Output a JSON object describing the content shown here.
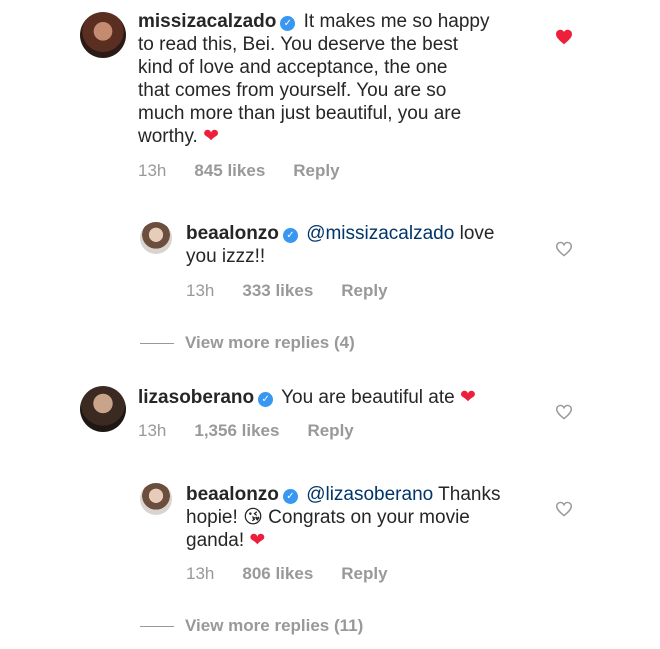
{
  "comments": [
    {
      "username": "missizacalzado",
      "text_lines": [
        "It makes me so happy",
        "to read this, Bei. You deserve the best",
        "kind of love and acceptance, the one",
        "that comes from yourself. You are so",
        "much more than just beautiful, you are",
        "worthy."
      ],
      "emoji_end": "❤",
      "time": "13h",
      "likes": "845 likes",
      "reply_label": "Reply",
      "liked": true
    },
    {
      "username": "beaalonzo",
      "mention": "@missizacalzado",
      "text_after_mention": "love",
      "text_line2": "you izzz!!",
      "time": "13h",
      "likes": "333 likes",
      "reply_label": "Reply",
      "liked": false
    },
    {
      "username": "lizasoberano",
      "text": "You are beautiful ate",
      "emoji_end": "❤",
      "time": "13h",
      "likes": "1,356 likes",
      "reply_label": "Reply",
      "liked": false
    },
    {
      "username": "beaalonzo",
      "mention": "@lizasoberano",
      "text_after_mention": "Thanks",
      "line2_pre": "hopie!",
      "kiss_emoji": "😘",
      "line2_post": "Congrats on your movie",
      "line3": "ganda!",
      "emoji_end": "❤",
      "time": "13h",
      "likes": "806 likes",
      "reply_label": "Reply",
      "liked": false
    }
  ],
  "view_more_1": "View more replies (4)",
  "view_more_2": "View more replies (11)",
  "verified_glyph": "✓",
  "colors": {
    "heart_liked": "#ed1f3a",
    "icon_outline": "#999999",
    "muted": "#999999",
    "mention": "#003569",
    "verified": "#3897f0"
  },
  "icons": {
    "liked": "heart-filled-icon",
    "unliked": "heart-outline-icon"
  }
}
